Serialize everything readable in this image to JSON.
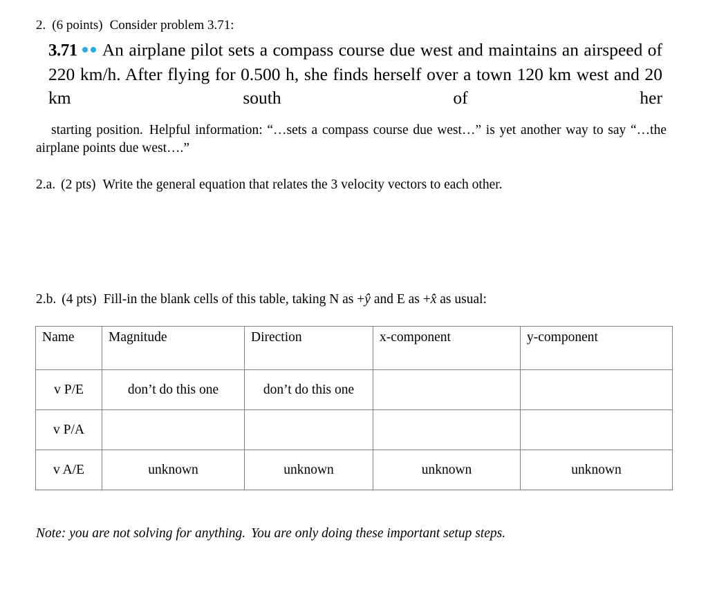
{
  "question": {
    "number": "2.",
    "points": "(6 points)",
    "prompt": "Consider problem 3.71:"
  },
  "excerpt": {
    "problem_number": "3.71",
    "difficulty_dots": 2,
    "difficulty_dot_color": "#29ABE2",
    "text": "An airplane pilot sets a compass course due west and maintains an airspeed of 220 km/h. After flying for 0.500 h, she finds herself over a town 120 km west and 20 km south of her",
    "line1": "An airplane pilot sets a compass course due west and",
    "line2": "maintains an airspeed of 220 km/h. After flying for 0.500 h, she",
    "line3": "finds herself over a town 120 km west and 20 km south of her"
  },
  "continuation": {
    "part1": "starting position.",
    "part2": "Helpful information: “…sets a compass course due west…” is yet another way to say “…the airplane points due west….”"
  },
  "subquestion_a": {
    "label": "2.a.",
    "points": "(2 pts)",
    "text": "Write the general equation that relates the 3 velocity vectors to each other."
  },
  "subquestion_b": {
    "label": "2.b.",
    "points": "(4 pts)",
    "text_before_y": "Fill-in the blank cells of this table, taking N as +",
    "y_hat": "ŷ",
    "text_between": " and E as +",
    "x_hat": "x̂",
    "text_after": " as usual:"
  },
  "table": {
    "headers": [
      "Name",
      "Magnitude",
      "Direction",
      "x-component",
      "y-component"
    ],
    "rows": [
      {
        "name": "v P/E",
        "magnitude": "don’t do this one",
        "direction": "don’t do this one",
        "x_component": "",
        "y_component": ""
      },
      {
        "name": "v P/A",
        "magnitude": "",
        "direction": "",
        "x_component": "",
        "y_component": ""
      },
      {
        "name": "v A/E",
        "magnitude": "unknown",
        "direction": "unknown",
        "x_component": "unknown",
        "y_component": "unknown"
      }
    ]
  },
  "note": {
    "part1": "Note: you are not solving for anything.",
    "part2": "You are only doing these important setup steps."
  }
}
